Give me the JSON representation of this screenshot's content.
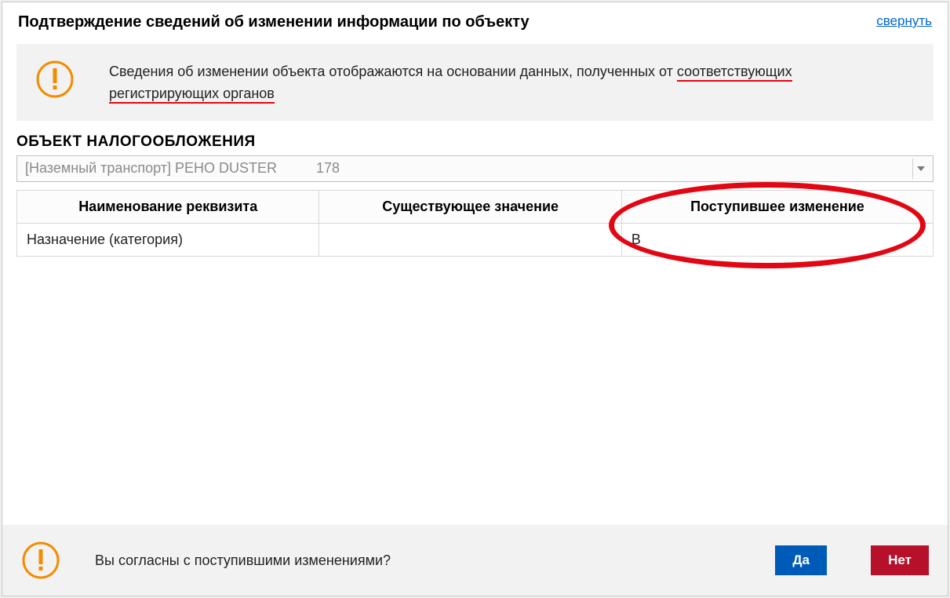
{
  "header": {
    "title": "Подтверждение сведений об изменении информации по объекту",
    "collapse": "свернуть"
  },
  "info": {
    "text_prefix": "Сведения об изменении объекта отображаются на основании данных, полученных от ",
    "underlined_1": "соответствующих",
    "space": " ",
    "underlined_2": "регистрирующих органов"
  },
  "section": {
    "label": "ОБЪЕКТ НАЛОГООБЛОЖЕНИЯ"
  },
  "select": {
    "value": "[Наземный транспорт] РЕНО DUSTER          178"
  },
  "table": {
    "headers": {
      "name": "Наименование реквизита",
      "existing": "Существующее значение",
      "incoming": "Поступившее изменение"
    },
    "row1": {
      "name": "Назначение (категория)",
      "existing": "",
      "incoming": "В"
    }
  },
  "footer": {
    "question": "Вы согласны с поступившими изменениями?",
    "yes": "Да",
    "no": "Нет"
  }
}
